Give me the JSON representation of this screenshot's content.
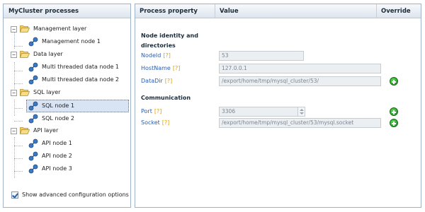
{
  "left_panel": {
    "title": "MyCluster processes",
    "tree": [
      {
        "label": "Management layer",
        "expanded": true,
        "children": [
          {
            "label": "Management node 1"
          }
        ]
      },
      {
        "label": "Data layer",
        "expanded": true,
        "children": [
          {
            "label": "Multi threaded data node 1"
          },
          {
            "label": "Multi threaded data node 2"
          }
        ]
      },
      {
        "label": "SQL layer",
        "expanded": true,
        "children": [
          {
            "label": "SQL node 1",
            "selected": true
          },
          {
            "label": "SQL node 2"
          }
        ]
      },
      {
        "label": "API layer",
        "expanded": true,
        "children": [
          {
            "label": "API node 1"
          },
          {
            "label": "API node 2"
          },
          {
            "label": "API node 3"
          }
        ]
      }
    ],
    "toggle_symbol": "−",
    "advanced_option": {
      "label": "Show advanced configuration options",
      "checked": true
    }
  },
  "right_panel": {
    "headers": {
      "property": "Process property",
      "value": "Value",
      "override": "Override"
    },
    "help_marker": "[?]",
    "sections": [
      {
        "title": "Node identity and directories",
        "properties": [
          {
            "name": "NodeId",
            "value": "53",
            "override": false
          },
          {
            "name": "HostName",
            "value": "127.0.0.1",
            "override": false
          },
          {
            "name": "DataDir",
            "value": "/export/home/tmp/mysql_cluster/53/",
            "override": true
          }
        ]
      },
      {
        "title": "Communication",
        "properties": [
          {
            "name": "Port",
            "value": "3306",
            "override": true,
            "spinner": true
          },
          {
            "name": "Socket",
            "value": "/export/home/tmp/mysql_cluster/53/mysql.socket",
            "override": true
          }
        ]
      }
    ]
  },
  "colors": {
    "accent": "#2a5db0",
    "help": "#e0a000",
    "override": "#1f8b1f",
    "selection": "#d8e3f3"
  }
}
